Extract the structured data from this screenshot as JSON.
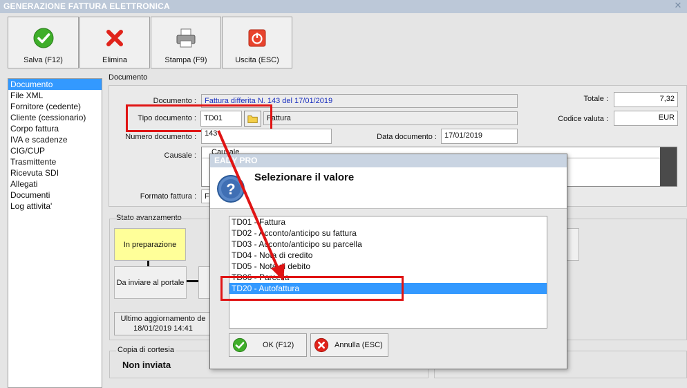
{
  "window": {
    "title": "GENERAZIONE FATTURA ELETTRONICA"
  },
  "toolbar": [
    {
      "label": "Salva (F12)",
      "icon": "check-icon"
    },
    {
      "label": "Elimina",
      "icon": "delete-x-icon"
    },
    {
      "label": "Stampa (F9)",
      "icon": "printer-icon"
    },
    {
      "label": "Uscita (ESC)",
      "icon": "exit-power-icon"
    }
  ],
  "sidebar": {
    "items": [
      {
        "label": "Documento",
        "selected": true
      },
      {
        "label": "File XML"
      },
      {
        "label": "Fornitore (cedente)"
      },
      {
        "label": "Cliente (cessionario)"
      },
      {
        "label": "Corpo fattura"
      },
      {
        "label": "IVA e scadenze"
      },
      {
        "label": "CIG/CUP"
      },
      {
        "label": "Trasmittente"
      },
      {
        "label": "Ricevuta SDI"
      },
      {
        "label": "Allegati"
      },
      {
        "label": "Documenti"
      },
      {
        "label": "Log attivita'"
      }
    ]
  },
  "documento": {
    "group_title": "Documento",
    "documento_label": "Documento :",
    "documento_value": "Fattura differita N. 143 del 17/01/2019",
    "tipo_label": "Tipo documento :",
    "tipo_value": "TD01",
    "tipo_desc": "Fattura",
    "numero_label": "Numero documento :",
    "numero_value": "143",
    "data_label": "Data documento :",
    "data_value": "17/01/2019",
    "causale_label": "Causale :",
    "causale_header": "Causale",
    "formato_label": "Formato fattura :",
    "formato_value": "F",
    "totale_label": "Totale :",
    "totale_value": "7,32",
    "valuta_label": "Codice valuta :",
    "valuta_value": "EUR"
  },
  "stato": {
    "group_title": "Stato avanzamento",
    "step1": "In preparazione",
    "step2": "Da inviare al portale",
    "last_update_line1": "Ultimo aggiornamento de",
    "last_update_line2": "18/01/2019 14:41"
  },
  "cortesia": {
    "group_title": "Copia di cortesia",
    "value": "Non inviata"
  },
  "modal": {
    "title": "EADY PRO",
    "heading": "Selezionare il valore",
    "options": [
      "TD01 - Fattura",
      "TD02 - Acconto/anticipo su fattura",
      "TD03 - Acconto/anticipo su parcella",
      "TD04 - Nota di credito",
      "TD05 - Nota di debito",
      "TD06 - Parcella",
      "TD20 - Autofattura"
    ],
    "selected_index": 6,
    "ok_label": "OK (F12)",
    "cancel_label": "Annulla (ESC)"
  },
  "colors": {
    "selection": "#3399ff",
    "highlight_frame": "#e01414",
    "step_active": "#ffff99"
  }
}
